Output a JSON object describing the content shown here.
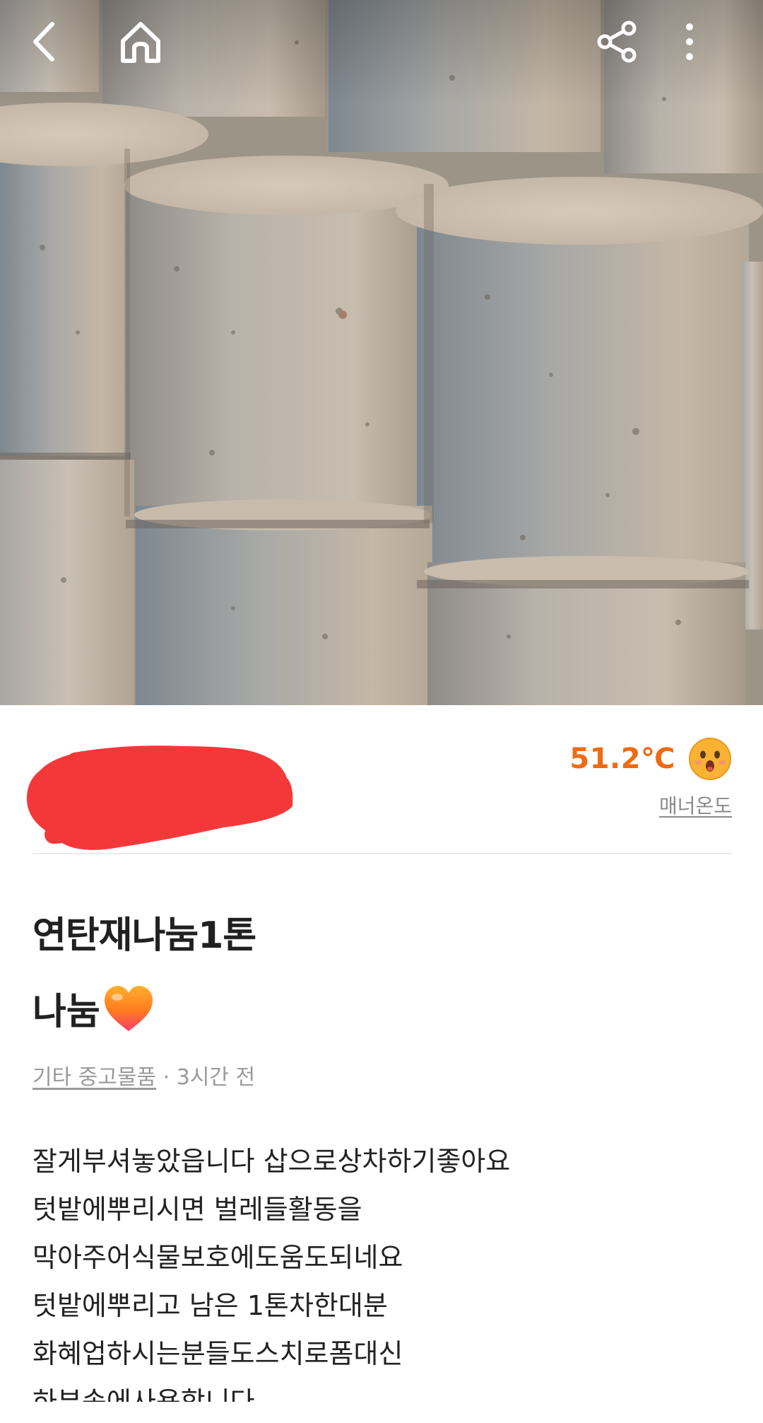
{
  "topbar": {
    "icons": [
      "back-icon",
      "home-icon",
      "share-icon",
      "more-vertical-icon"
    ]
  },
  "seller": {
    "name_redacted": true,
    "manner_temperature": "51.2℃",
    "manner_label": "매너온도",
    "manner_icon": "surprised-face-icon"
  },
  "post": {
    "title_line1": "연탄재나눔1톤",
    "title_line2": "나눔",
    "title_emoji": "orange-heart-icon",
    "category": "기타 중고물품",
    "separator": " · ",
    "time_ago": "3시간 전",
    "body_lines": [
      "잘게부셔놓았읍니다 삽으로상차하기좋아요",
      "텃밭에뿌리시면 벌레들활동을",
      "막아주어식물보호에도움도되네요",
      "텃밭에뿌리고 남은 1톤차한대분",
      "화혜업하시는분들도스치로폼대신",
      "하부솜에사용합니다"
    ]
  },
  "colors": {
    "accent_orange": "#ee6a14",
    "redaction_red": "#f4383a",
    "text_primary": "#212121",
    "text_secondary": "#9a9a9a"
  }
}
